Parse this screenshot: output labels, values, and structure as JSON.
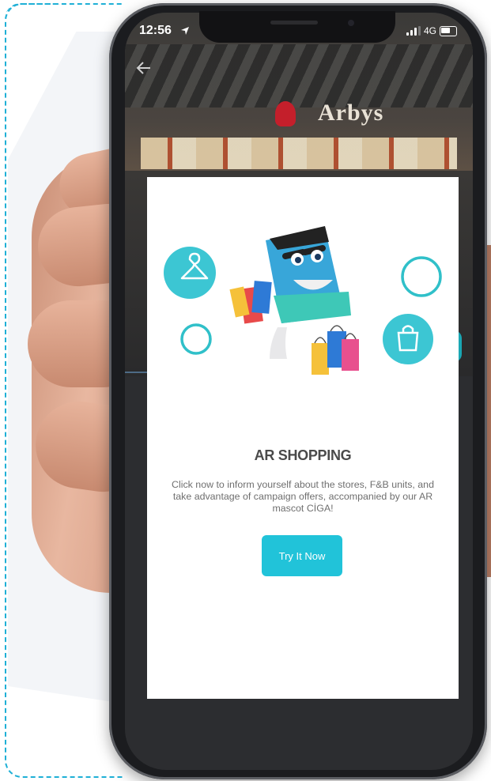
{
  "status_bar": {
    "time": "12:56",
    "network": "4G"
  },
  "background_store": {
    "sign_text": "Arbys"
  },
  "modal": {
    "title": "AR SHOPPING",
    "description": "Click now to inform yourself about the stores, F&B units, and take advantage of campaign offers, accompanied by our AR mascot CİGA!",
    "button_label": "Try It Now"
  },
  "icons": [
    "location-arrow-icon",
    "signal-icon",
    "battery-icon",
    "back-arrow-icon",
    "hanger-icon",
    "shopping-bag-icon",
    "ring-icon",
    "mascot-illustration"
  ],
  "colors": {
    "accent": "#21c3d9",
    "title": "#4a4a4a",
    "text": "#6f6f6f",
    "frame_dash": "#1fb0d6"
  }
}
